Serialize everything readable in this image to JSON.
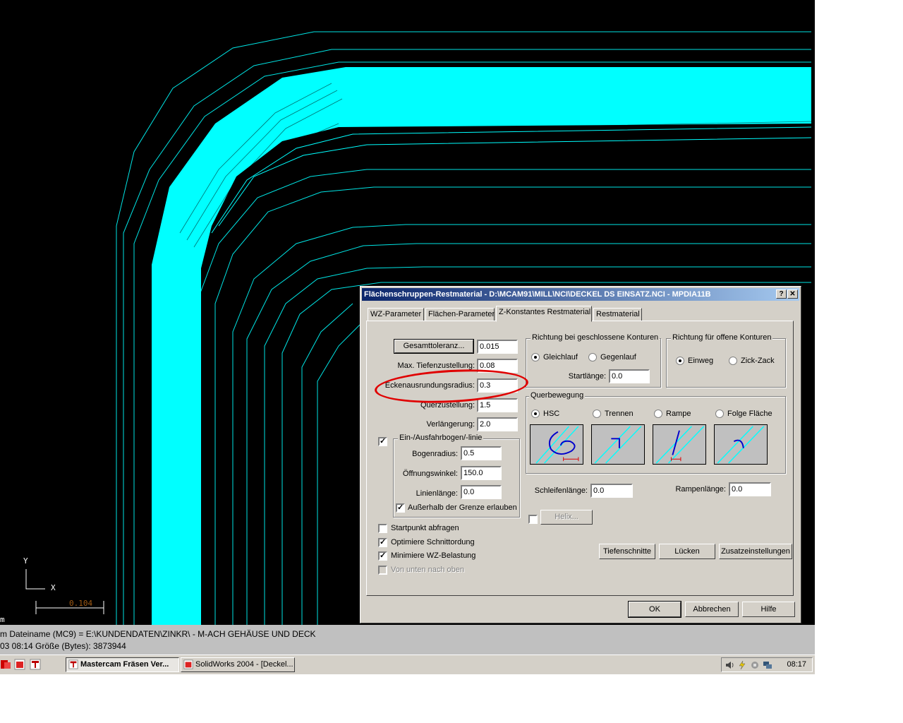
{
  "viewport": {
    "axis_y": "Y",
    "axis_x": "X",
    "scale_value": "0.104",
    "corner_mark": "m",
    "colors": {
      "background": "#000000",
      "toolpath": "#00ffff"
    }
  },
  "status": {
    "line1": "m Dateiname (MC9) = E:\\KUNDENDATEN\\ZINKR\\ - M-ACH GEHÄUSE UND DECK",
    "line2": "03 08:14  Größe (Bytes):  3873944"
  },
  "taskbar": {
    "quick_icons": [
      "app-icon",
      "solidworks-icon",
      "mastercam-icon"
    ],
    "items": [
      {
        "label": "Mastercam Fräsen Ver...",
        "active": true
      },
      {
        "label": "SolidWorks 2004 - [Deckel...",
        "active": false
      }
    ],
    "clock": "08:17"
  },
  "dialog": {
    "title": "Flächenschruppen-Restmaterial - D:\\MCAM91\\MILL\\NCI\\DECKEL DS EINSATZ.NCI - MPDIA11B",
    "help_btn": "?",
    "close_btn": "✕",
    "tabs": [
      {
        "label": "WZ-Parameter",
        "selected": false
      },
      {
        "label": "Flächen-Parameter",
        "selected": false
      },
      {
        "label": "Z-Konstantes Restmaterial",
        "selected": true
      },
      {
        "label": "Restmaterial",
        "selected": false
      }
    ],
    "left": {
      "gesamttoleranz_btn": "Gesamttoleranz...",
      "gesamttoleranz": "0.015",
      "max_tiefen_label": "Max. Tiefenzustellung:",
      "max_tiefen": "0.08",
      "ecken_label": "Eckenausrundungsradius:",
      "ecken": "0.3",
      "quer_label": "Querzustellung:",
      "quer": "1.5",
      "verl_label": "Verlängerung:",
      "verl": "2.0",
      "arc_group": "Ein-/Ausfahrbogen/-linie",
      "arc_checked": "✓",
      "bogen_label": "Bogenradius:",
      "bogen": "0.5",
      "oeff_label": "Öffnungswinkel:",
      "oeff": "150.0",
      "linien_label": "Linienlänge:",
      "linien": "0.0",
      "ausserhalb_label": "Außerhalb der Grenze erlauben",
      "ausserhalb_checked": "✓",
      "startpunkt_label": "Startpunkt abfragen",
      "startpunkt_checked": "",
      "optimiere_label": "Optimiere Schnittordung",
      "optimiere_checked": "✓",
      "minimiere_label": "Minimiere WZ-Belastung",
      "minimiere_checked": "✓",
      "vonunten_label": "Von unten nach oben",
      "vonunten_checked": ""
    },
    "closed": {
      "group": "Richtung bei geschlossene Konturen",
      "gleichlauf": "Gleichlauf",
      "gegenlauf": "Gegenlauf",
      "startlaenge_label": "Startlänge:",
      "startlaenge": "0.0"
    },
    "open": {
      "group": "Richtung für offene Konturen",
      "einweg": "Einweg",
      "zickzack": "Zick-Zack"
    },
    "quer": {
      "group": "Querbewegung",
      "options": [
        "HSC",
        "Trennen",
        "Rampe",
        "Folge Fläche"
      ],
      "selected": "HSC",
      "icons": [
        "hsc-loop-icon",
        "trennen-step-icon",
        "rampe-ramp-icon",
        "folge-arc-icon"
      ],
      "schleifen_label": "Schleifenlänge:",
      "schleifen": "0.0",
      "rampen_label": "Rampenlänge:",
      "rampen": "0.0"
    },
    "helix_btn": "Helix...",
    "helix_checked": "",
    "tiefenschnitte_btn": "Tiefenschnitte",
    "luecken_btn": "Lücken",
    "zusatz_btn": "Zusatzeinstellungen",
    "ok_btn": "OK",
    "abbrechen_btn": "Abbrechen",
    "hilfe_btn": "Hilfe"
  }
}
